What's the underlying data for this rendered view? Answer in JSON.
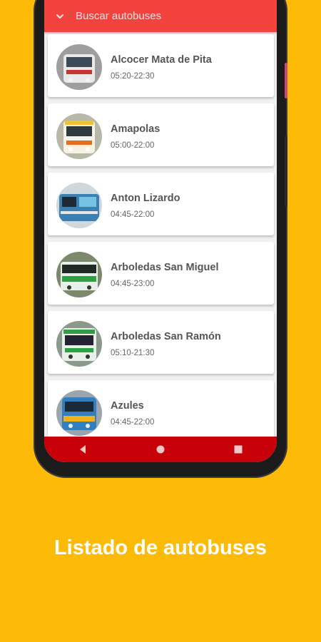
{
  "appbar": {
    "title": "Buscar autobuses",
    "color": "#F4433E"
  },
  "routes": [
    {
      "name": "Alcocer Mata de Pita",
      "hours": "05:20-22:30",
      "bus_color": "#e9e9e9",
      "accent": "#c0392b"
    },
    {
      "name": "Amapolas",
      "hours": "05:00-22:00",
      "bus_color": "#f7f2e4",
      "accent": "#f2c230"
    },
    {
      "name": "Anton Lizardo",
      "hours": "04:45-22:00",
      "bus_color": "#3b7fb3",
      "accent": "#76c2e3"
    },
    {
      "name": "Arboledas San Miguel",
      "hours": "04:45-23:00",
      "bus_color": "#e8efe8",
      "accent": "#2f9e44"
    },
    {
      "name": "Arboledas San Ramón",
      "hours": "05:10-21:30",
      "bus_color": "#e9efe9",
      "accent": "#2f9e44"
    },
    {
      "name": "Azules",
      "hours": "04:45-22:00",
      "bus_color": "#2f7fc2",
      "accent": "#f2b01e"
    }
  ],
  "navbar": {
    "color": "#C8000A",
    "icons": [
      "back-icon",
      "home-icon",
      "recents-icon"
    ]
  },
  "caption": "Listado de autobuses",
  "background": "#FDBB07"
}
